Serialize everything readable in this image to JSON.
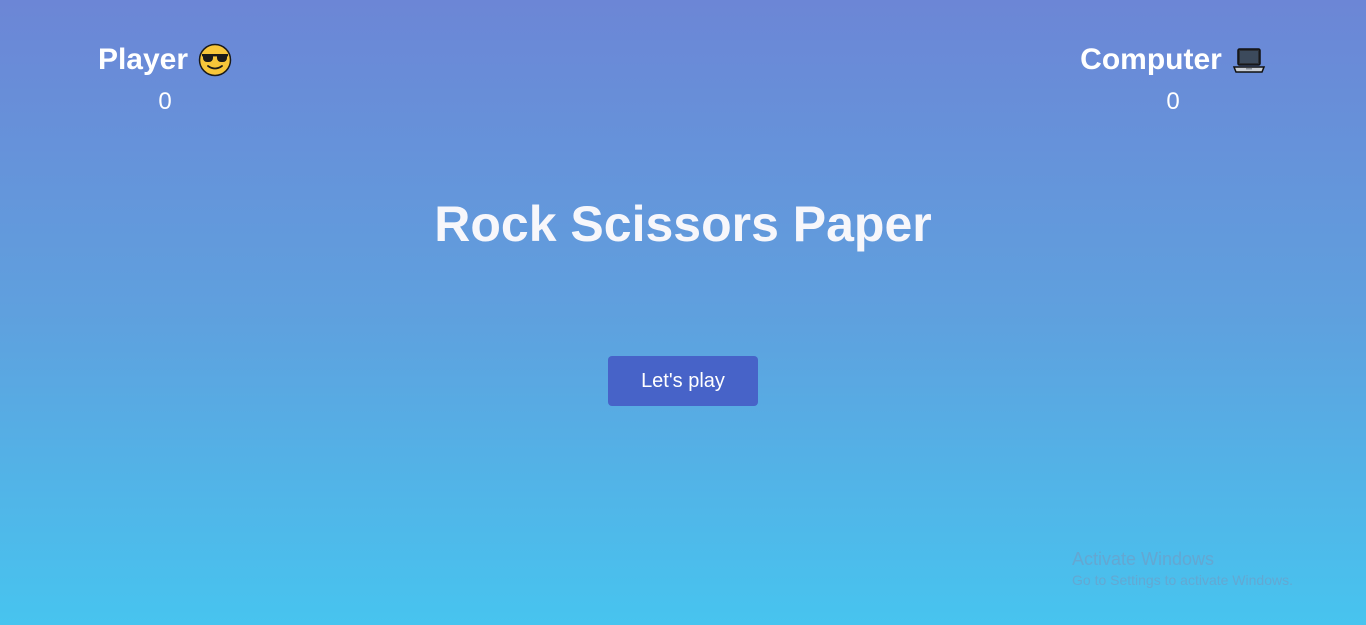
{
  "player": {
    "label": "Player",
    "icon": "sunglasses-face-icon",
    "score": "0"
  },
  "computer": {
    "label": "Computer",
    "icon": "laptop-icon",
    "score": "0"
  },
  "title": "Rock Scissors Paper",
  "play_button": {
    "label": "Let's play"
  },
  "watermark": {
    "title": "Activate Windows",
    "subtitle": "Go to Settings to activate Windows."
  },
  "colors": {
    "gradient_top": "#6c86d6",
    "gradient_bottom": "#47c4ef",
    "button_bg": "#4763c8",
    "text": "#ffffff"
  }
}
